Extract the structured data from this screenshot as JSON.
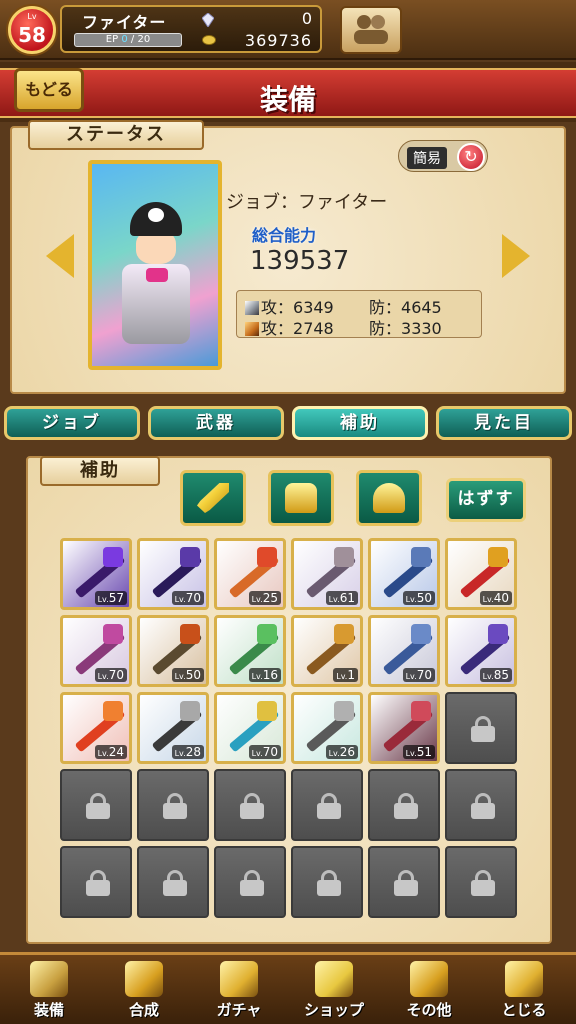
{
  "header": {
    "level_tag": "Lv",
    "level": "58",
    "job_name": "ファイター",
    "ep_label": "EP",
    "ep_current": "0",
    "ep_max": "/ 20",
    "gem_count": "0",
    "coin_count": "369736"
  },
  "title_bar": {
    "back_label": "もどる",
    "title": "装備"
  },
  "status": {
    "section_label": "ステータス",
    "simple_label": "簡易",
    "job_line": "ジョブ：ファイター",
    "power_label": "総合能力",
    "power_value": "139537",
    "physical": {
      "atk_label": "攻：",
      "atk": "6349",
      "def_label": "防：",
      "def": "4645"
    },
    "magic": {
      "atk_label": "攻：",
      "atk": "2748",
      "def_label": "防：",
      "def": "3330"
    }
  },
  "category_tabs": [
    {
      "label": "ジョブ",
      "active": false
    },
    {
      "label": "武器",
      "active": false
    },
    {
      "label": "補助",
      "active": true
    },
    {
      "label": "見た目",
      "active": false
    }
  ],
  "support": {
    "section_label": "補助",
    "filters": [
      "sword-icon",
      "armor-icon",
      "helmet-icon"
    ],
    "remove_label": "はずす",
    "lv_prefix": "Lv.",
    "items": [
      {
        "lv": "57",
        "bg": "#6a4ab0",
        "weapon": "#3a1a6a",
        "head": "#7a3ae0"
      },
      {
        "lv": "70",
        "bg": "#c8c2e6",
        "weapon": "#2a1a5a",
        "head": "#5a3aa8"
      },
      {
        "lv": "25",
        "bg": "#e8c8c0",
        "weapon": "#d86a28",
        "head": "#e04a2a"
      },
      {
        "lv": "61",
        "bg": "#d8d0e8",
        "weapon": "#6a5a70",
        "head": "#a0909a"
      },
      {
        "lv": "50",
        "bg": "#b8c8e8",
        "weapon": "#2a4a8a",
        "head": "#5a7ab8"
      },
      {
        "lv": "40",
        "bg": "#e8d8c0",
        "weapon": "#c82828",
        "head": "#e0a020"
      },
      {
        "lv": "70",
        "bg": "#d8c8e0",
        "weapon": "#8a3a7a",
        "head": "#c04aa0"
      },
      {
        "lv": "50",
        "bg": "#d8c0a0",
        "weapon": "#5a4a30",
        "head": "#c8501a"
      },
      {
        "lv": "16",
        "bg": "#c0e0c8",
        "weapon": "#3a8a4a",
        "head": "#5ac060"
      },
      {
        "lv": "1",
        "bg": "#e0c8a8",
        "weapon": "#8a5a20",
        "head": "#d89a30"
      },
      {
        "lv": "70",
        "bg": "#c8c8d8",
        "weapon": "#3a5a9a",
        "head": "#6a8ac8"
      },
      {
        "lv": "85",
        "bg": "#c8c0e0",
        "weapon": "#3a2a7a",
        "head": "#6a4ac0"
      },
      {
        "lv": "24",
        "bg": "#f0c0b8",
        "weapon": "#e04020",
        "head": "#f08030"
      },
      {
        "lv": "28",
        "bg": "#c8d8e8",
        "weapon": "#3a3a3a",
        "head": "#a8a8a8"
      },
      {
        "lv": "70",
        "bg": "#d8e8d8",
        "weapon": "#2aa0c0",
        "head": "#e0c040"
      },
      {
        "lv": "26",
        "bg": "#c8e8e0",
        "weapon": "#5a5a5a",
        "head": "#b0b0b0"
      },
      {
        "lv": "51",
        "bg": "#6a3a4a",
        "weapon": "#9a2a3a",
        "head": "#d04a5a"
      }
    ],
    "locked_count": 13
  },
  "nav": [
    {
      "label": "装備",
      "icon": "equip-icon",
      "color": "#c8a040"
    },
    {
      "label": "合成",
      "icon": "hammer-icon",
      "color": "#d8a020"
    },
    {
      "label": "ガチャ",
      "icon": "gacha-icon",
      "color": "#e0b030"
    },
    {
      "label": "ショップ",
      "icon": "crystal-icon",
      "color": "#e8c840"
    },
    {
      "label": "その他",
      "icon": "gear-icon",
      "color": "#d8a020"
    },
    {
      "label": "とじる",
      "icon": "close-lion-icon",
      "color": "#e0b030"
    }
  ]
}
